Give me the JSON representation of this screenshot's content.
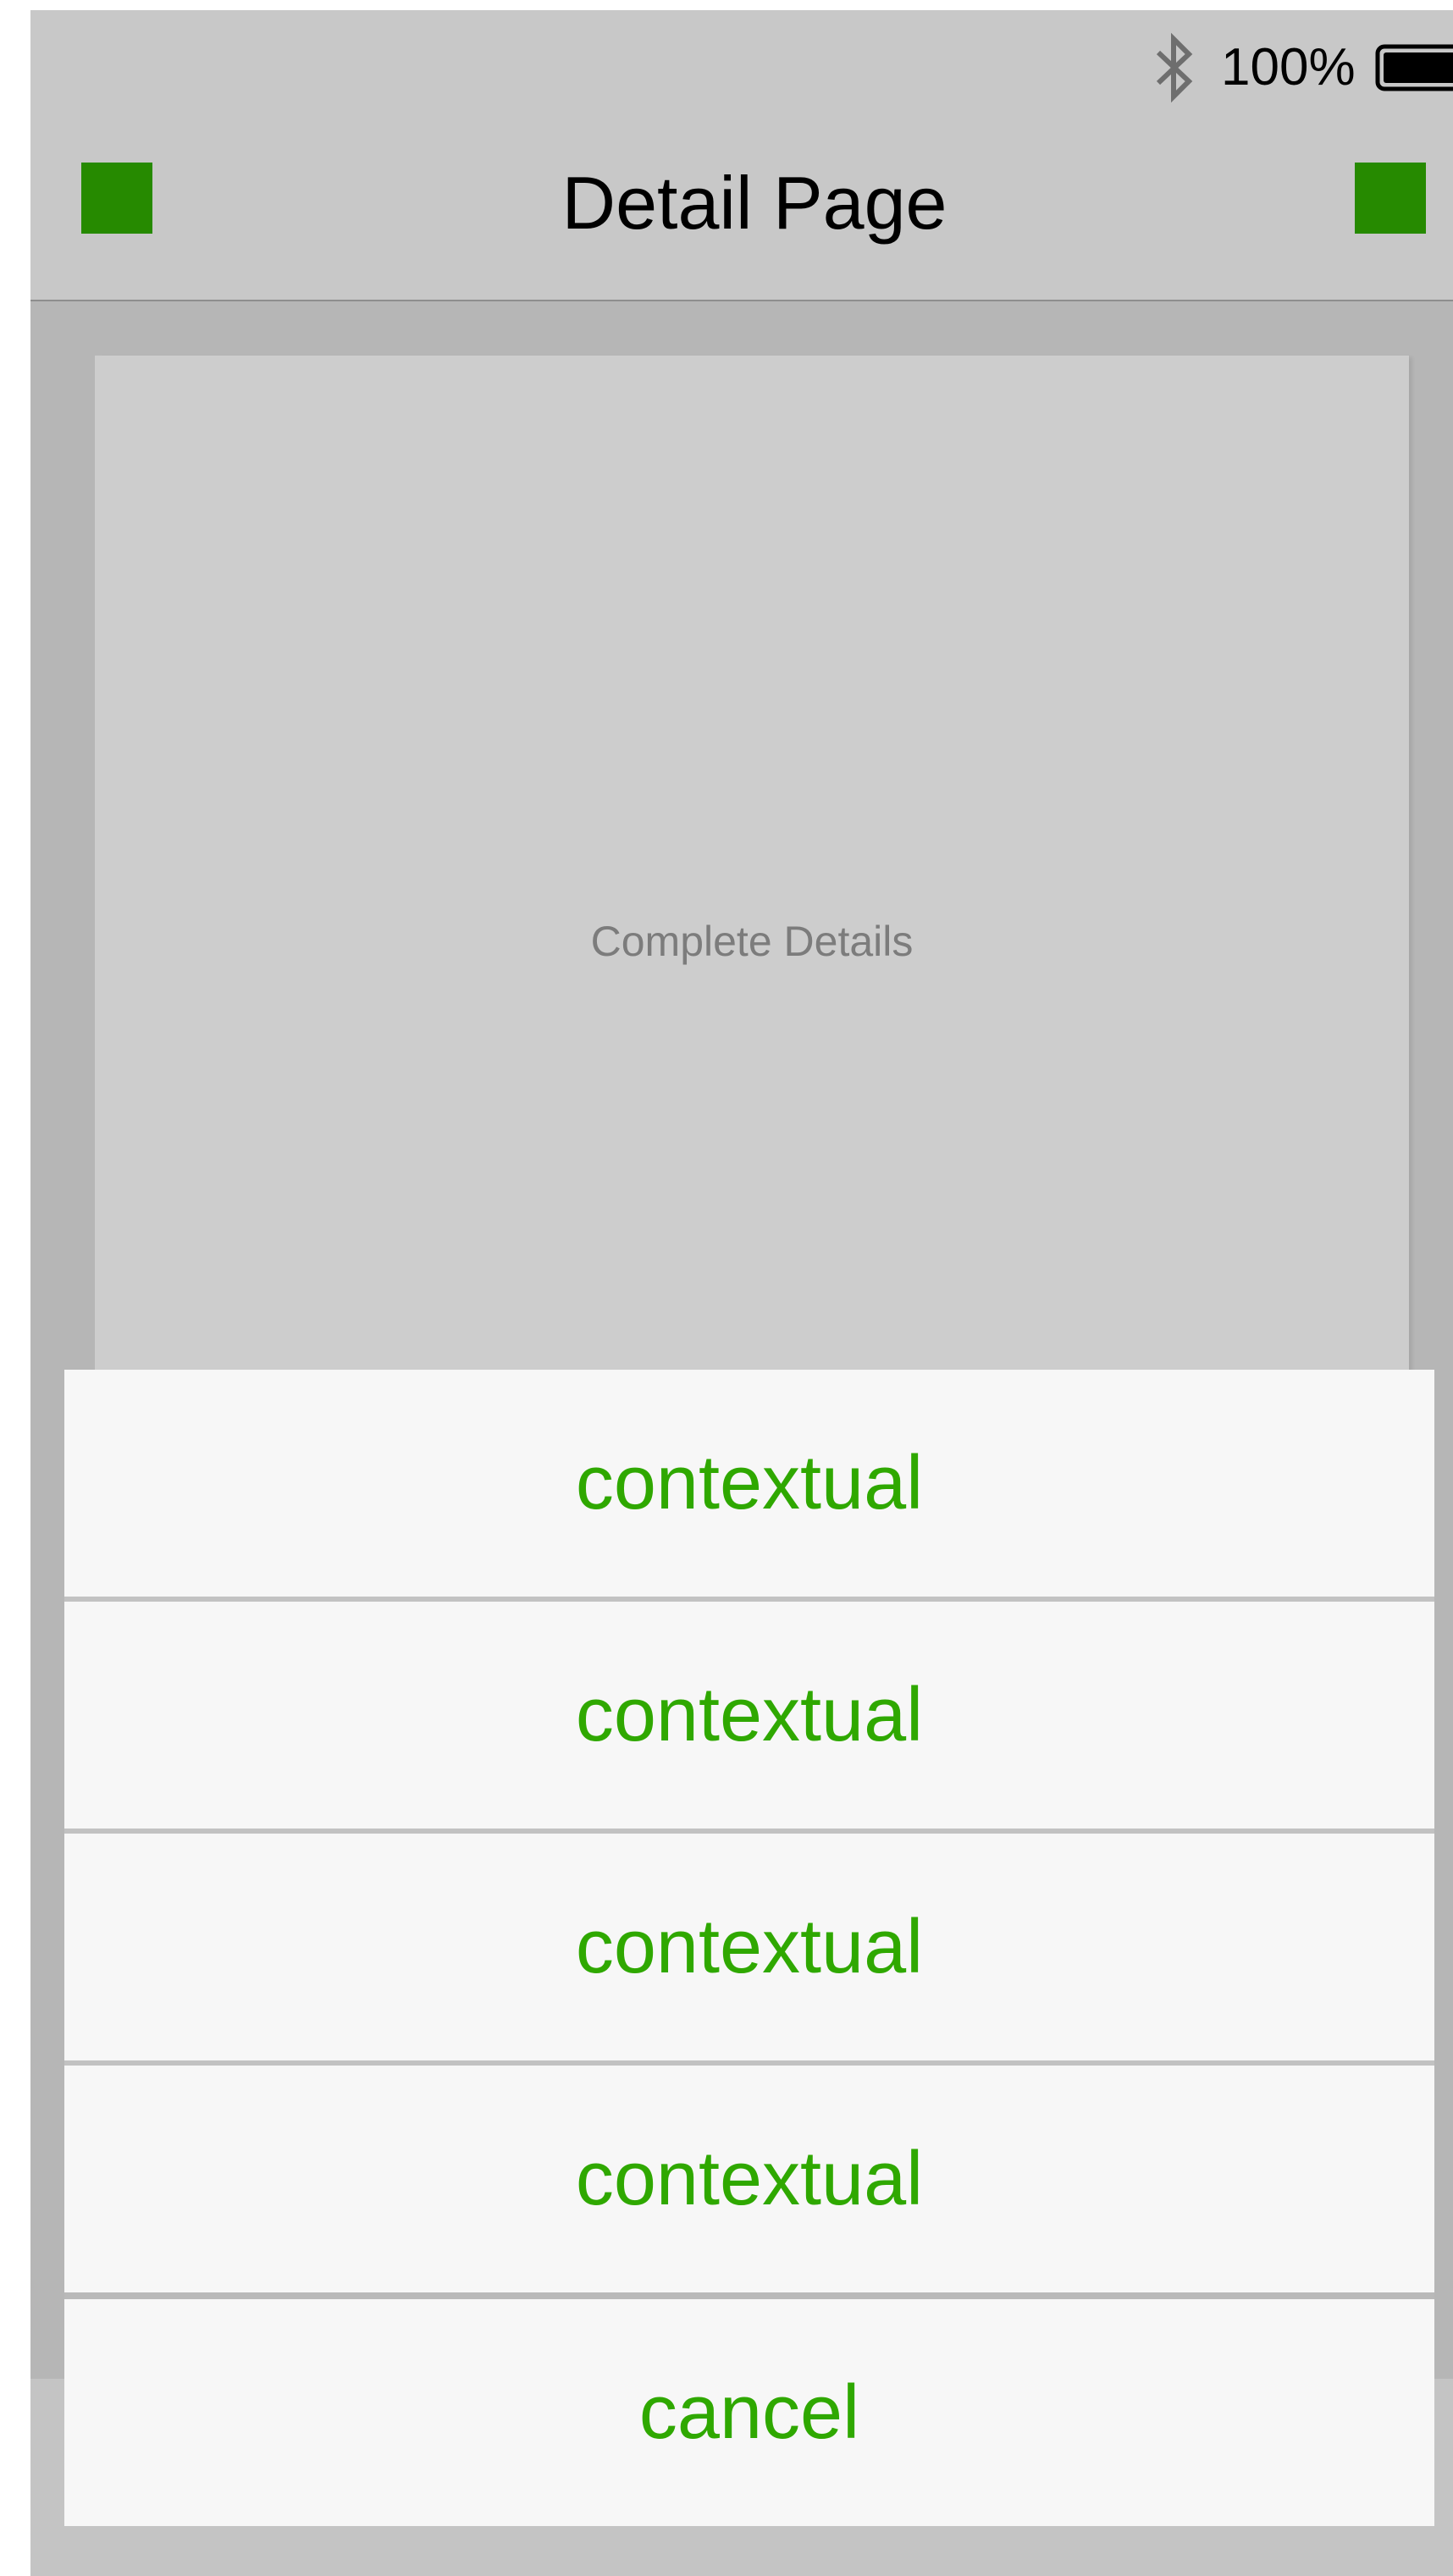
{
  "status_bar": {
    "battery_percent": "100%",
    "icons": [
      "bluetooth-icon",
      "battery-icon"
    ]
  },
  "nav_bar": {
    "title": "Detail Page",
    "accent_color": "#268a00"
  },
  "content": {
    "detail_text": "Complete Details"
  },
  "action_sheet": {
    "options": [
      {
        "label": "contextual"
      },
      {
        "label": "contextual"
      },
      {
        "label": "contextual"
      },
      {
        "label": "contextual"
      }
    ],
    "cancel_label": "cancel",
    "text_color": "#2fa800"
  }
}
